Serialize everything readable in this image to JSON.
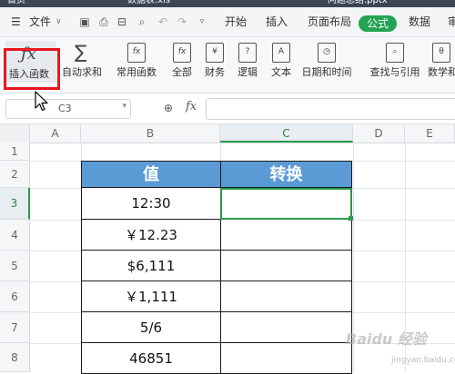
{
  "titlebar": {
    "tabs": [
      "首页",
      "数据表.xls",
      "问题总结.pptx"
    ]
  },
  "menubar": {
    "file_label": "文件",
    "tabs": [
      "开始",
      "插入",
      "页面布局",
      "公式",
      "数据",
      "审"
    ],
    "active_tab": "公式"
  },
  "ribbon": {
    "insert_function": "插入函数",
    "autosum": "自动求和",
    "common_functions": "常用函数",
    "all": "全部",
    "finance": "财务",
    "logic": "逻辑",
    "text": "文本",
    "datetime": "日期和时间",
    "lookup": "查找与引用",
    "math": "数学和"
  },
  "formulabar": {
    "name_box": "C3",
    "fx": "fx",
    "formula_value": ""
  },
  "grid": {
    "columns": [
      "A",
      "B",
      "C",
      "D",
      "E"
    ],
    "active_column": "C",
    "rows": [
      "1",
      "2",
      "3",
      "4",
      "5",
      "6",
      "7",
      "8"
    ],
    "active_row": "3"
  },
  "table": {
    "header_value": "值",
    "header_convert": "转换",
    "values": [
      "12:30",
      "￥12.23",
      "$6,111",
      "￥1,111",
      "5/6",
      "46851"
    ]
  },
  "colors": {
    "header_blue": "#5b9bd5",
    "accent_green": "#23a455",
    "highlight_red": "#e8161f"
  },
  "watermark": {
    "main": "Baidu 经验",
    "sub": "jingyan.baidu.com"
  }
}
